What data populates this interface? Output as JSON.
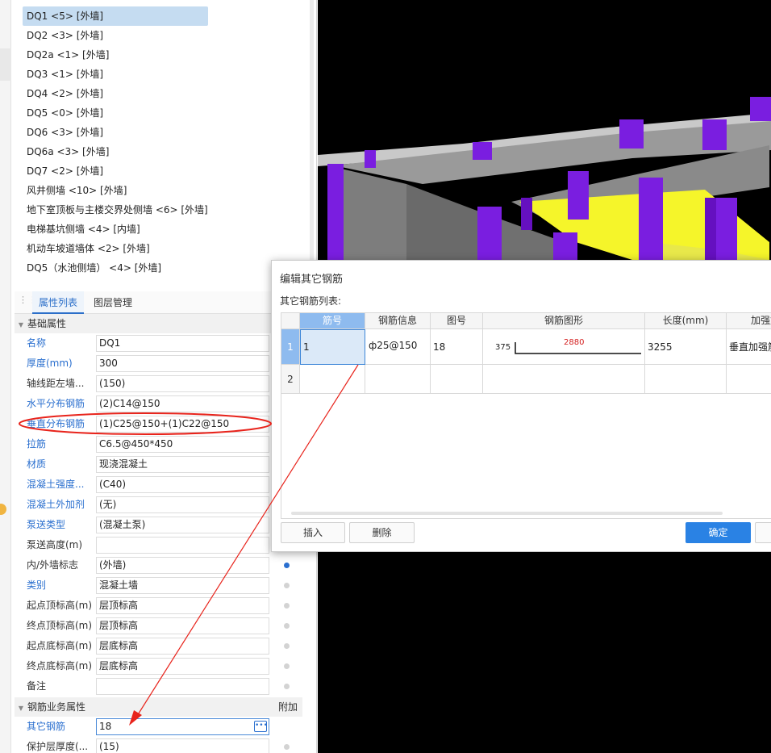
{
  "walls": [
    {
      "label": "DQ1 <5> [外墙]",
      "selected": true
    },
    {
      "label": "DQ2 <3> [外墙]"
    },
    {
      "label": "DQ2a <1> [外墙]"
    },
    {
      "label": "DQ3 <1> [外墙]"
    },
    {
      "label": "DQ4 <2> [外墙]"
    },
    {
      "label": "DQ5 <0> [外墙]"
    },
    {
      "label": "DQ6 <3> [外墙]"
    },
    {
      "label": "DQ6a <3> [外墙]"
    },
    {
      "label": "DQ7 <2> [外墙]"
    },
    {
      "label": "风井侧墙 <10> [外墙]"
    },
    {
      "label": "地下室顶板与主楼交界处侧墙 <6> [外墙]"
    },
    {
      "label": "电梯基坑侧墙 <4> [内墙]"
    },
    {
      "label": "机动车坡道墙体 <2> [外墙]"
    },
    {
      "label": "DQ5（水池侧墙） <4> [外墙]"
    }
  ],
  "tabs": {
    "props": "属性列表",
    "layers": "图层管理"
  },
  "sections": {
    "basic": "基础属性",
    "rebar": "钢筋业务属性",
    "rebar_extra": "附加"
  },
  "props": [
    {
      "label": "名称",
      "value": "DQ1",
      "blue": true
    },
    {
      "label": "厚度(mm)",
      "value": "300",
      "blue": true
    },
    {
      "label": "轴线距左墙...",
      "value": "(150)",
      "blue": false
    },
    {
      "label": "水平分布钢筋",
      "value": "(2)C14@150",
      "blue": true
    },
    {
      "label": "垂直分布钢筋",
      "value": "(1)C25@150+(1)C22@150",
      "blue": true
    },
    {
      "label": "拉筋",
      "value": "C6.5@450*450",
      "blue": true
    },
    {
      "label": "材质",
      "value": "现浇混凝土",
      "blue": true
    },
    {
      "label": "混凝土强度...",
      "value": "(C40)",
      "blue": true
    },
    {
      "label": "混凝土外加剂",
      "value": "(无)",
      "blue": true
    },
    {
      "label": "泵送类型",
      "value": "(混凝土泵)",
      "blue": true
    },
    {
      "label": "泵送高度(m)",
      "value": "",
      "blue": false
    },
    {
      "label": "内/外墙标志",
      "value": "(外墙)",
      "blue": false,
      "radio": "on"
    },
    {
      "label": "类别",
      "value": "混凝土墙",
      "blue": true,
      "radio": "off"
    },
    {
      "label": "起点顶标高(m)",
      "value": "层顶标高",
      "blue": false,
      "radio": "off"
    },
    {
      "label": "终点顶标高(m)",
      "value": "层顶标高",
      "blue": false,
      "radio": "off"
    },
    {
      "label": "起点底标高(m)",
      "value": "层底标高",
      "blue": false,
      "radio": "off"
    },
    {
      "label": "终点底标高(m)",
      "value": "层底标高",
      "blue": false,
      "radio": "off"
    },
    {
      "label": "备注",
      "value": "",
      "blue": false,
      "radio": "off"
    }
  ],
  "rebar_props": [
    {
      "label": "其它钢筋",
      "value": "18",
      "blue": true
    },
    {
      "label": "保护层厚度(...",
      "value": "(15)",
      "blue": false,
      "radio": "off"
    }
  ],
  "dialog": {
    "title": "编辑其它钢筋",
    "list_label": "其它钢筋列表:",
    "columns": [
      "筋号",
      "钢筋信息",
      "图号",
      "钢筋图形",
      "长度(mm)",
      "加强筋"
    ],
    "rows": [
      {
        "num": "1",
        "bar_no": "1",
        "info": "ф25@150",
        "fig_no": "18",
        "shape_left": "375",
        "shape_mid": "2880",
        "length": "3255",
        "type": "垂直加强筋"
      },
      {
        "num": "2",
        "bar_no": "",
        "info": "",
        "fig_no": "",
        "shape_left": "",
        "shape_mid": "",
        "length": "",
        "type": ""
      }
    ],
    "buttons": {
      "insert": "插入",
      "delete": "删除",
      "ok": "确定"
    }
  },
  "colors": {
    "accent": "#2a82e4",
    "selection": "#c5dcf1",
    "annotation": "#e8241c",
    "beam_purple": "#7a1ee0",
    "slab_yellow": "#f5f52a"
  }
}
